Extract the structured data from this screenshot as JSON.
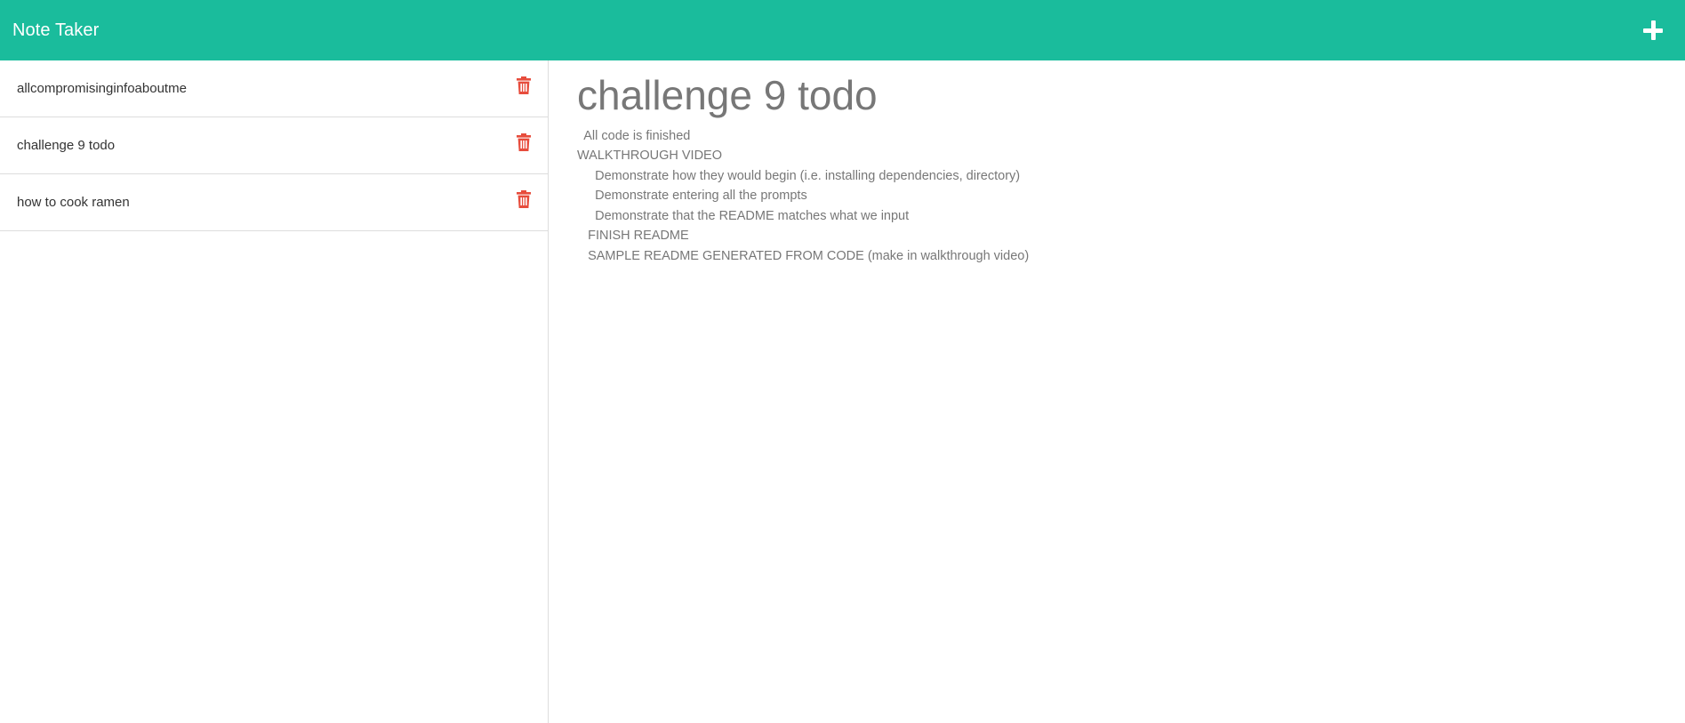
{
  "navbar": {
    "brand": "Note Taker",
    "add_icon": "plus-icon"
  },
  "colors": {
    "navbar_bg": "#1abc9c",
    "trash": "#e74c3c",
    "text_muted": "#777777",
    "list_text": "#333333"
  },
  "sidebar": {
    "notes": [
      {
        "title": "allcompromisinginfoaboutme",
        "delete_icon": "trash-icon"
      },
      {
        "title": "challenge 9 todo",
        "delete_icon": "trash-icon"
      },
      {
        "title": "how to cook ramen",
        "delete_icon": "trash-icon"
      }
    ]
  },
  "editor": {
    "title": "challenge 9 todo",
    "body": "  All code is finished\nWALKTHROUGH VIDEO\n     Demonstrate how they would begin (i.e. installing dependencies, directory)\n     Demonstrate entering all the prompts\n     Demonstrate that the README matches what we input\n   FINISH README\n   SAMPLE README GENERATED FROM CODE (make in walkthrough video)"
  }
}
